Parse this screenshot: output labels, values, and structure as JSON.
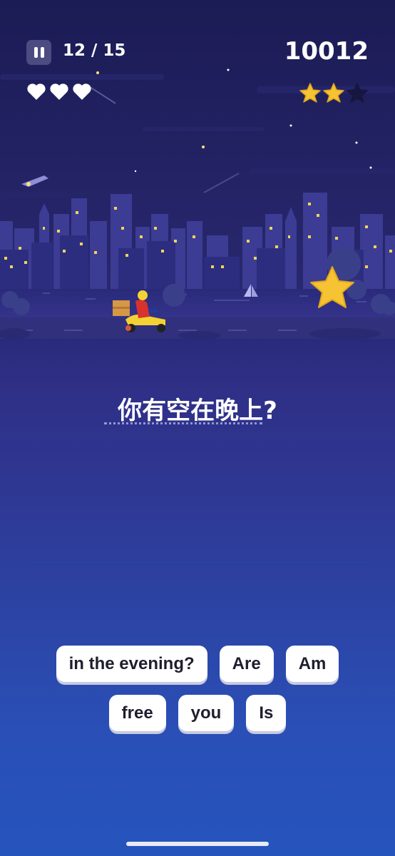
{
  "hud": {
    "progress": "12 / 15",
    "score": "10012",
    "lives": 3,
    "stars_earned": 2,
    "stars_total": 3
  },
  "question": {
    "prompt": "你有空在晚上?"
  },
  "word_bank": {
    "row1": [
      "in the evening?",
      "Are",
      "Am"
    ],
    "row2": [
      "free",
      "you",
      "Is"
    ]
  },
  "colors": {
    "sky_top": "#1c1d57",
    "background_bottom": "#2554bd",
    "star_gold": "#f6c332",
    "chip_bg": "#ffffff"
  }
}
